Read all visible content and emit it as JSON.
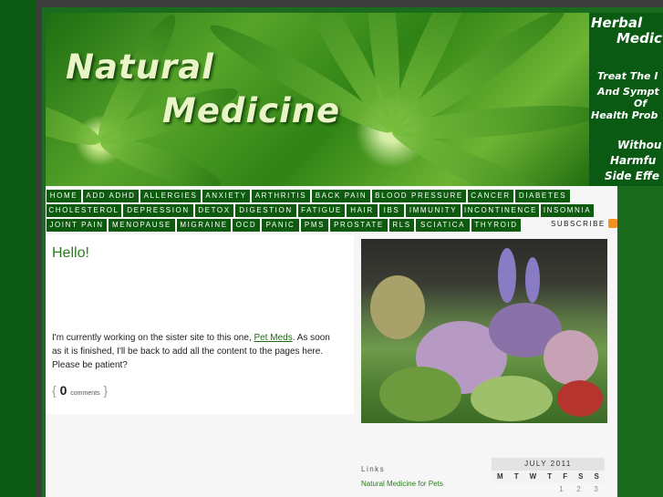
{
  "header": {
    "title_line1": "Natural",
    "title_line2": "Medicine",
    "promo": [
      "Herbal",
      "Medic",
      "Treat The I",
      "And Sympt",
      "Of",
      "Health Prob",
      "Withou",
      "Harmfu",
      "Side Effe"
    ]
  },
  "nav": {
    "row1": [
      "HOME",
      "ADD ADHD",
      "ALLERGIES",
      "ANXIETY",
      "ARTHRITIS",
      "BACK PAIN",
      "BLOOD PRESSURE",
      "CANCER",
      "DIABETES"
    ],
    "row2": [
      "CHOLESTEROL",
      "DEPRESSION",
      "DETOX",
      "DIGESTION",
      "FATIGUE",
      "HAIR",
      "IBS",
      "IMMUNITY",
      "INCONTINENCE",
      "INSOMNIA"
    ],
    "row3": [
      "JOINT PAIN",
      "MENOPAUSE",
      "MIGRAINE",
      "OCD",
      "PANIC",
      "PMS",
      "PROSTATE",
      "RLS",
      "SCIATICA",
      "THYROID"
    ],
    "subscribe": "SUBSCRIBE"
  },
  "post": {
    "title": "Hello!",
    "body_before": "I'm currently working on the sister site to this one, ",
    "link": "Pet Meds",
    "body_after": ". As soon as it is finished, I'll be back to add all the content to the pages here. Please be patient?",
    "comment_count": "0",
    "comment_label": "comments"
  },
  "sidebar": {
    "links_heading": "Links",
    "links": [
      "Natural Medicine for Pets"
    ],
    "calendar": {
      "month": "JULY 2011",
      "days": [
        "M",
        "T",
        "W",
        "T",
        "F",
        "S",
        "S"
      ],
      "first_row": [
        "",
        "",
        "",
        "",
        "1",
        "2",
        "3"
      ]
    }
  },
  "colors": {
    "nav_bg": "#0e5b10",
    "accent": "#2b7a1d",
    "frame": "#1a6b1d"
  }
}
